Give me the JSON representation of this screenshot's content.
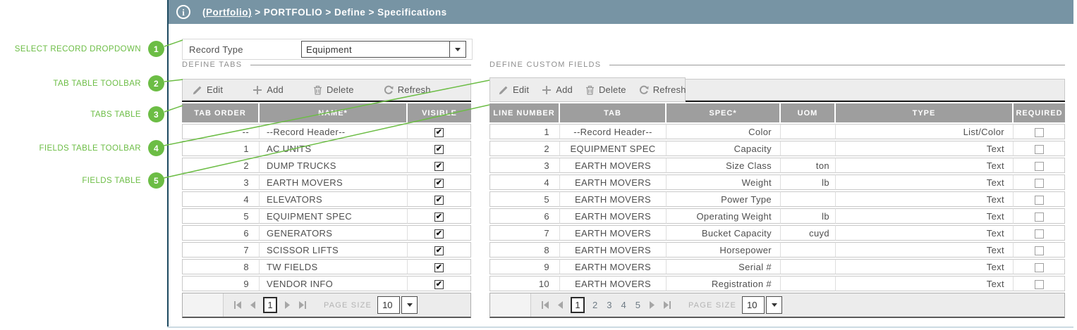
{
  "colors": {
    "topbar": "#7794a4",
    "annotation_green": "#6cbd45",
    "table_header": "#9e9e9e",
    "frame_left_border": "#1e4a60"
  },
  "icons": {
    "info": "i-in-circle",
    "edit": "pencil",
    "add": "plus",
    "delete": "trash-can",
    "refresh": "circular-arrows",
    "dropdown_arrow": "▼",
    "pager_first": "⏮",
    "pager_prev": "◀",
    "pager_next": "▶",
    "pager_last": "⏭",
    "checkbox_checked": "✔"
  },
  "annotations": [
    {
      "num": "1",
      "label": "SELECT RECORD DROPDOWN"
    },
    {
      "num": "2",
      "label": "TAB TABLE TOOLBAR"
    },
    {
      "num": "3",
      "label": "TABS TABLE"
    },
    {
      "num": "4",
      "label": "FIELDS TABLE TOOLBAR"
    },
    {
      "num": "5",
      "label": "FIELDS TABLE"
    }
  ],
  "breadcrumb": {
    "link": "(Portfolio)",
    "rest": " > PORTFOLIO > Define > Specifications"
  },
  "record_type": {
    "label": "Record Type",
    "value": "Equipment"
  },
  "tabs_section": {
    "title": "DEFINE TABS",
    "toolbar": {
      "edit": "Edit",
      "add": "Add",
      "delete": "Delete",
      "refresh": "Refresh"
    },
    "columns": [
      "TAB ORDER",
      "NAME*",
      "VISIBLE"
    ],
    "rows": [
      {
        "order": "--",
        "name": "--Record Header--",
        "visible": true
      },
      {
        "order": "1",
        "name": "AC UNITS",
        "visible": true
      },
      {
        "order": "2",
        "name": "DUMP TRUCKS",
        "visible": true
      },
      {
        "order": "3",
        "name": "EARTH MOVERS",
        "visible": true
      },
      {
        "order": "4",
        "name": "ELEVATORS",
        "visible": true
      },
      {
        "order": "5",
        "name": "EQUIPMENT SPEC",
        "visible": true
      },
      {
        "order": "6",
        "name": "GENERATORS",
        "visible": true
      },
      {
        "order": "7",
        "name": "SCISSOR LIFTS",
        "visible": true
      },
      {
        "order": "8",
        "name": "TW FIELDS",
        "visible": true
      },
      {
        "order": "9",
        "name": "VENDOR INFO",
        "visible": true
      }
    ],
    "pager": {
      "current": "1",
      "page_size_label": "PAGE SIZE",
      "page_size": "10"
    }
  },
  "fields_section": {
    "title": "DEFINE CUSTOM FIELDS",
    "toolbar": {
      "edit": "Edit",
      "add": "Add",
      "delete": "Delete",
      "refresh": "Refresh"
    },
    "columns": [
      "LINE NUMBER",
      "TAB",
      "SPEC*",
      "UOM",
      "TYPE",
      "REQUIRED"
    ],
    "rows": [
      {
        "line": "1",
        "tab": "--Record Header--",
        "spec": "Color",
        "uom": "",
        "type": "List/Color",
        "required": false
      },
      {
        "line": "2",
        "tab": "EQUIPMENT SPEC",
        "spec": "Capacity",
        "uom": "",
        "type": "Text",
        "required": false
      },
      {
        "line": "3",
        "tab": "EARTH MOVERS",
        "spec": "Size Class",
        "uom": "ton",
        "type": "Text",
        "required": false
      },
      {
        "line": "4",
        "tab": "EARTH MOVERS",
        "spec": "Weight",
        "uom": "lb",
        "type": "Text",
        "required": false
      },
      {
        "line": "5",
        "tab": "EARTH MOVERS",
        "spec": "Power Type",
        "uom": "",
        "type": "Text",
        "required": false
      },
      {
        "line": "6",
        "tab": "EARTH MOVERS",
        "spec": "Operating Weight",
        "uom": "lb",
        "type": "Text",
        "required": false
      },
      {
        "line": "7",
        "tab": "EARTH MOVERS",
        "spec": "Bucket Capacity",
        "uom": "cuyd",
        "type": "Text",
        "required": false
      },
      {
        "line": "8",
        "tab": "EARTH MOVERS",
        "spec": "Horsepower",
        "uom": "",
        "type": "Text",
        "required": false
      },
      {
        "line": "9",
        "tab": "EARTH MOVERS",
        "spec": "Serial #",
        "uom": "",
        "type": "Text",
        "required": false
      },
      {
        "line": "10",
        "tab": "EARTH MOVERS",
        "spec": "Registration #",
        "uom": "",
        "type": "Text",
        "required": false
      }
    ],
    "pager": {
      "current": "1",
      "pages": [
        "1",
        "2",
        "3",
        "4",
        "5"
      ],
      "page_size_label": "PAGE SIZE",
      "page_size": "10"
    }
  }
}
